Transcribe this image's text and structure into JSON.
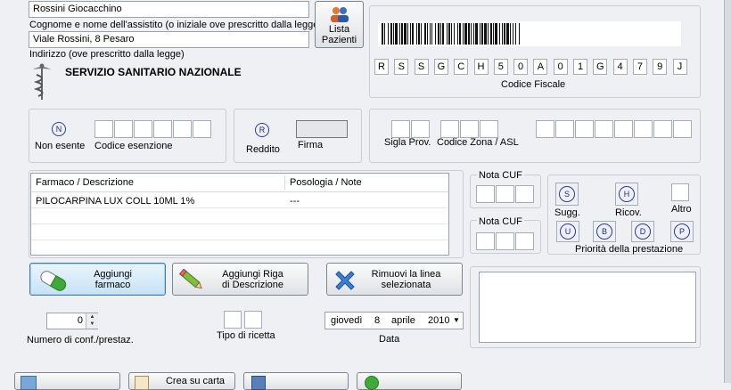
{
  "patient": {
    "name_value": "Rossini Giocacchino",
    "name_label": "Cognome e nome dell'assistito (o iniziale ove prescritto dalla legge)",
    "address_value": "Viale Rossini, 8 Pesaro",
    "address_label": "Indirizzo (ove prescritto dalla legge)",
    "service_name": "SERVIZIO SANITARIO NAZIONALE"
  },
  "patient_list_button": {
    "line1": "Lista",
    "line2": "Pazienti"
  },
  "codice_fiscale": {
    "chars": [
      "R",
      "S",
      "S",
      "G",
      "C",
      "H",
      "5",
      "0",
      "A",
      "0",
      "1",
      "G",
      "4",
      "7",
      "9",
      "J"
    ],
    "label": "Codice Fiscale"
  },
  "exemption": {
    "non_esente_letter": "N",
    "non_esente_label": "Non esente",
    "codice_esenzione_label": "Codice esenzione",
    "reddito_letter": "R",
    "reddito_label": "Reddito",
    "firma_label": "Firma"
  },
  "location": {
    "sigla_prov_label": "Sigla Prov.",
    "codice_zona_label": "Codice Zona / ASL"
  },
  "drug_table": {
    "columns": [
      "Farmaco / Descrizione",
      "Posologia / Note"
    ],
    "rows": [
      {
        "drug": "PILOCARPINA LUX COLL 10ML 1%",
        "dosage": "---"
      }
    ]
  },
  "nota_cuf": {
    "label1": "Nota CUF",
    "label2": "Nota CUF"
  },
  "priority": {
    "s_letter": "S",
    "s_label": "Sugg.",
    "h_letter": "H",
    "h_label": "Ricov.",
    "altro_label": "Altro",
    "u_letter": "U",
    "b_letter": "B",
    "d_letter": "D",
    "p_letter": "P",
    "priority_label": "Priorità della prestazione"
  },
  "actions": {
    "add_drug": {
      "line1": "Aggiungi",
      "line2": "farmaco"
    },
    "add_description": {
      "line1": "Aggiungi Riga",
      "line2": "di Descrizione"
    },
    "remove_line": {
      "line1": "Rimuovi la linea",
      "line2": "selezionata"
    }
  },
  "quantity": {
    "value": "0",
    "label": "Numero di conf./prestaz."
  },
  "ricetta": {
    "label": "Tipo di ricetta"
  },
  "date": {
    "weekday": "giovedì",
    "day": "8",
    "month": "aprile",
    "year": "2010",
    "label": "Data"
  },
  "bottom_buttons": {
    "crea_line1": "Crea su carta"
  }
}
